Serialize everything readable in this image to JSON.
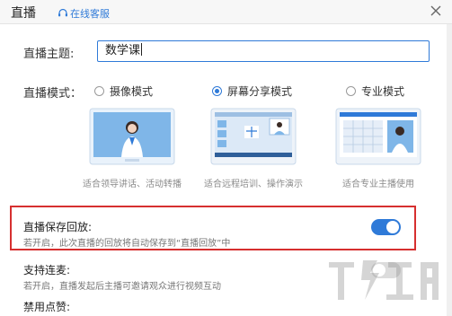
{
  "window": {
    "title": "直播",
    "support_link": "在线客服"
  },
  "topic": {
    "label": "直播主题:",
    "value": "数学课"
  },
  "mode": {
    "label": "直播模式：",
    "options": [
      {
        "label": "摄像模式",
        "selected": false,
        "caption": "适合领导讲话、活动转播"
      },
      {
        "label": "屏幕分享模式",
        "selected": true,
        "caption": "适合远程培训、操作演示"
      },
      {
        "label": "专业模式",
        "selected": false,
        "caption": "适合专业主播使用"
      }
    ]
  },
  "settings": {
    "save_replay": {
      "title": "直播保存回放:",
      "desc": "若开启，此次直播的回放将自动保存到“直播回放”中",
      "enabled": true
    },
    "mic_link": {
      "title": "支持连麦:",
      "desc": "若开启，直播发起后主播可邀请观众进行视频互动",
      "enabled": false
    },
    "disable_likes": {
      "title": "禁用点赞:"
    }
  },
  "colors": {
    "accent": "#2f7ad8",
    "highlight_border": "#d62f2f"
  },
  "icons": {
    "support": "headset-icon",
    "close": "close-icon"
  }
}
